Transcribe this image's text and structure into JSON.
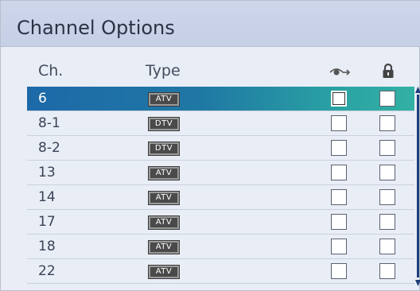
{
  "header": {
    "title": "Channel Options"
  },
  "columns": {
    "ch": "Ch.",
    "type": "Type",
    "skip_icon": "watch-skip-icon",
    "lock_icon": "lock-icon"
  },
  "channels": [
    {
      "ch": "6",
      "type": "ATV",
      "selected": true,
      "skip": false,
      "lock": false
    },
    {
      "ch": "8-1",
      "type": "DTV",
      "selected": false,
      "skip": false,
      "lock": false
    },
    {
      "ch": "8-2",
      "type": "DTV",
      "selected": false,
      "skip": false,
      "lock": false
    },
    {
      "ch": "13",
      "type": "ATV",
      "selected": false,
      "skip": false,
      "lock": false
    },
    {
      "ch": "14",
      "type": "ATV",
      "selected": false,
      "skip": false,
      "lock": false
    },
    {
      "ch": "17",
      "type": "ATV",
      "selected": false,
      "skip": false,
      "lock": false
    },
    {
      "ch": "18",
      "type": "ATV",
      "selected": false,
      "skip": false,
      "lock": false
    },
    {
      "ch": "22",
      "type": "ATV",
      "selected": false,
      "skip": false,
      "lock": false
    }
  ],
  "colors": {
    "selected_start": "#1d69a8",
    "selected_end": "#33b1a5",
    "scrollbar": "#1e3c7a",
    "header_bg": "#c5cfe5"
  }
}
